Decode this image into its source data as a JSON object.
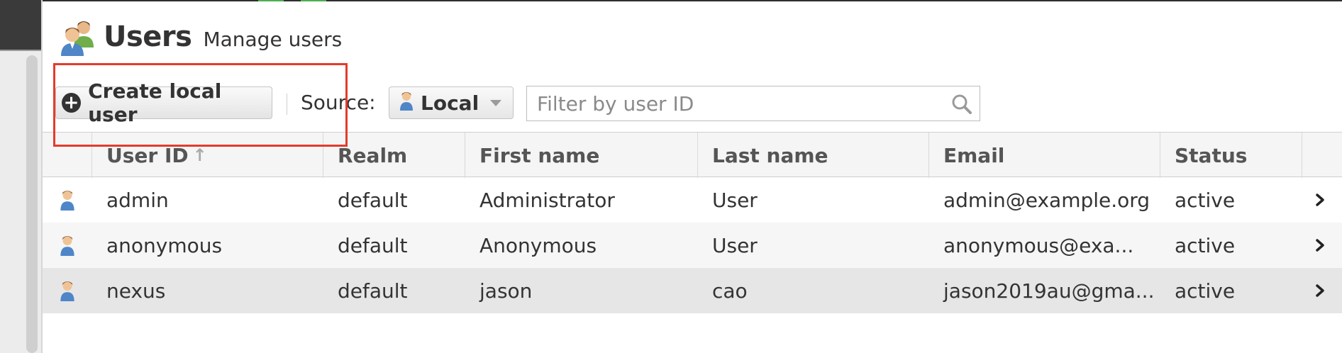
{
  "header": {
    "title": "Users",
    "subtitle": "Manage users"
  },
  "toolbar": {
    "create_label": "Create local user",
    "source_label": "Source:",
    "source_value": "Local",
    "filter_placeholder": "Filter by user ID"
  },
  "table": {
    "columns": [
      "User ID",
      "Realm",
      "First name",
      "Last name",
      "Email",
      "Status"
    ],
    "sort_indicator": "↑",
    "rows": [
      {
        "user_id": "admin",
        "realm": "default",
        "first_name": "Administrator",
        "last_name": "User",
        "email": "admin@example.org",
        "status": "active"
      },
      {
        "user_id": "anonymous",
        "realm": "default",
        "first_name": "Anonymous",
        "last_name": "User",
        "email": "anonymous@exa...",
        "status": "active"
      },
      {
        "user_id": "nexus",
        "realm": "default",
        "first_name": "jason",
        "last_name": "cao",
        "email": "jason2019au@gma...",
        "status": "active"
      }
    ]
  },
  "colors": {
    "annotation": "#e53b2c",
    "selected_row": "#e6e6e6"
  },
  "icons": [
    "users-icon",
    "plus-icon",
    "user-icon",
    "caret-down-icon",
    "search-icon",
    "chevron-right-icon"
  ]
}
